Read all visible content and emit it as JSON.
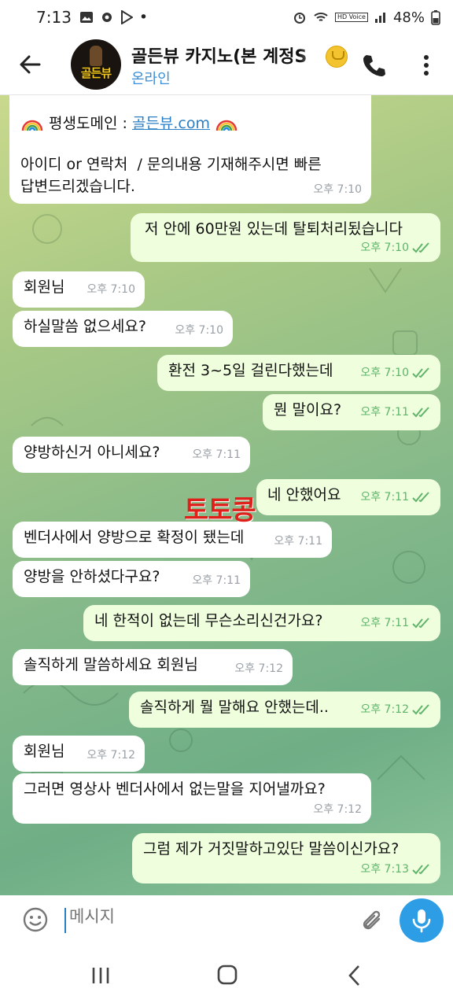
{
  "status_bar": {
    "time": "7:13",
    "dot": "•",
    "battery": "48%",
    "hd_label": "HD Voice"
  },
  "header": {
    "title": "골든뷰 카지노(본 계정S",
    "status": "온라인",
    "avatar_text": "골든뷰"
  },
  "watermark": "토토콩",
  "messages": [
    {
      "dir": "in",
      "parts": [
        "평생도메인 : ",
        "골든뷰.com"
      ],
      "line2": "",
      "line3": "아이디 or 연락처  / 문의내용 기재해주시면 빠른",
      "line4": "답변드리겠습니다.",
      "time": "오후 7:10"
    },
    {
      "dir": "out",
      "text": "저 안에 60만원 있는데 탈퇴처리됬습니다",
      "time": "오후 7:10"
    },
    {
      "dir": "in",
      "text": "회원님",
      "time": "오후 7:10"
    },
    {
      "dir": "in",
      "text": "하실말씀 없으세요?",
      "time": "오후 7:10"
    },
    {
      "dir": "out",
      "text": "환전 3~5일 걸린다했는데",
      "time": "오후 7:10"
    },
    {
      "dir": "out",
      "text": "뭔 말이요?",
      "time": "오후 7:11"
    },
    {
      "dir": "in",
      "text": "양방하신거 아니세요?",
      "time": "오후 7:11"
    },
    {
      "dir": "out",
      "text": "네 안했어요",
      "time": "오후 7:11"
    },
    {
      "dir": "in",
      "text": "벤더사에서 양방으로 확정이 됐는데",
      "time": "오후 7:11"
    },
    {
      "dir": "in",
      "text": "양방을 안하셨다구요?",
      "time": "오후 7:11"
    },
    {
      "dir": "out",
      "text": "네 한적이 없는데 무슨소리신건가요?",
      "time": "오후 7:11"
    },
    {
      "dir": "in",
      "text": "솔직하게 말씀하세요 회원님",
      "time": "오후 7:12"
    },
    {
      "dir": "out",
      "text": "솔직하게 뭘 말해요 안했는데..",
      "time": "오후 7:12"
    },
    {
      "dir": "in",
      "text": "회원님",
      "time": "오후 7:12"
    },
    {
      "dir": "in",
      "text": "그러면 영상사 벤더사에서 없는말을 지어낼까요?",
      "time": "오후 7:12"
    },
    {
      "dir": "out",
      "text": "그럼 제가 거짓말하고있단 말씀이신가요?",
      "time": "오후 7:13"
    }
  ],
  "input": {
    "placeholder": "메시지"
  },
  "colors": {
    "accent": "#2d9ee6",
    "outgoing_bubble": "#effedd",
    "incoming_bubble": "#ffffff",
    "check": "#5fb46a"
  }
}
